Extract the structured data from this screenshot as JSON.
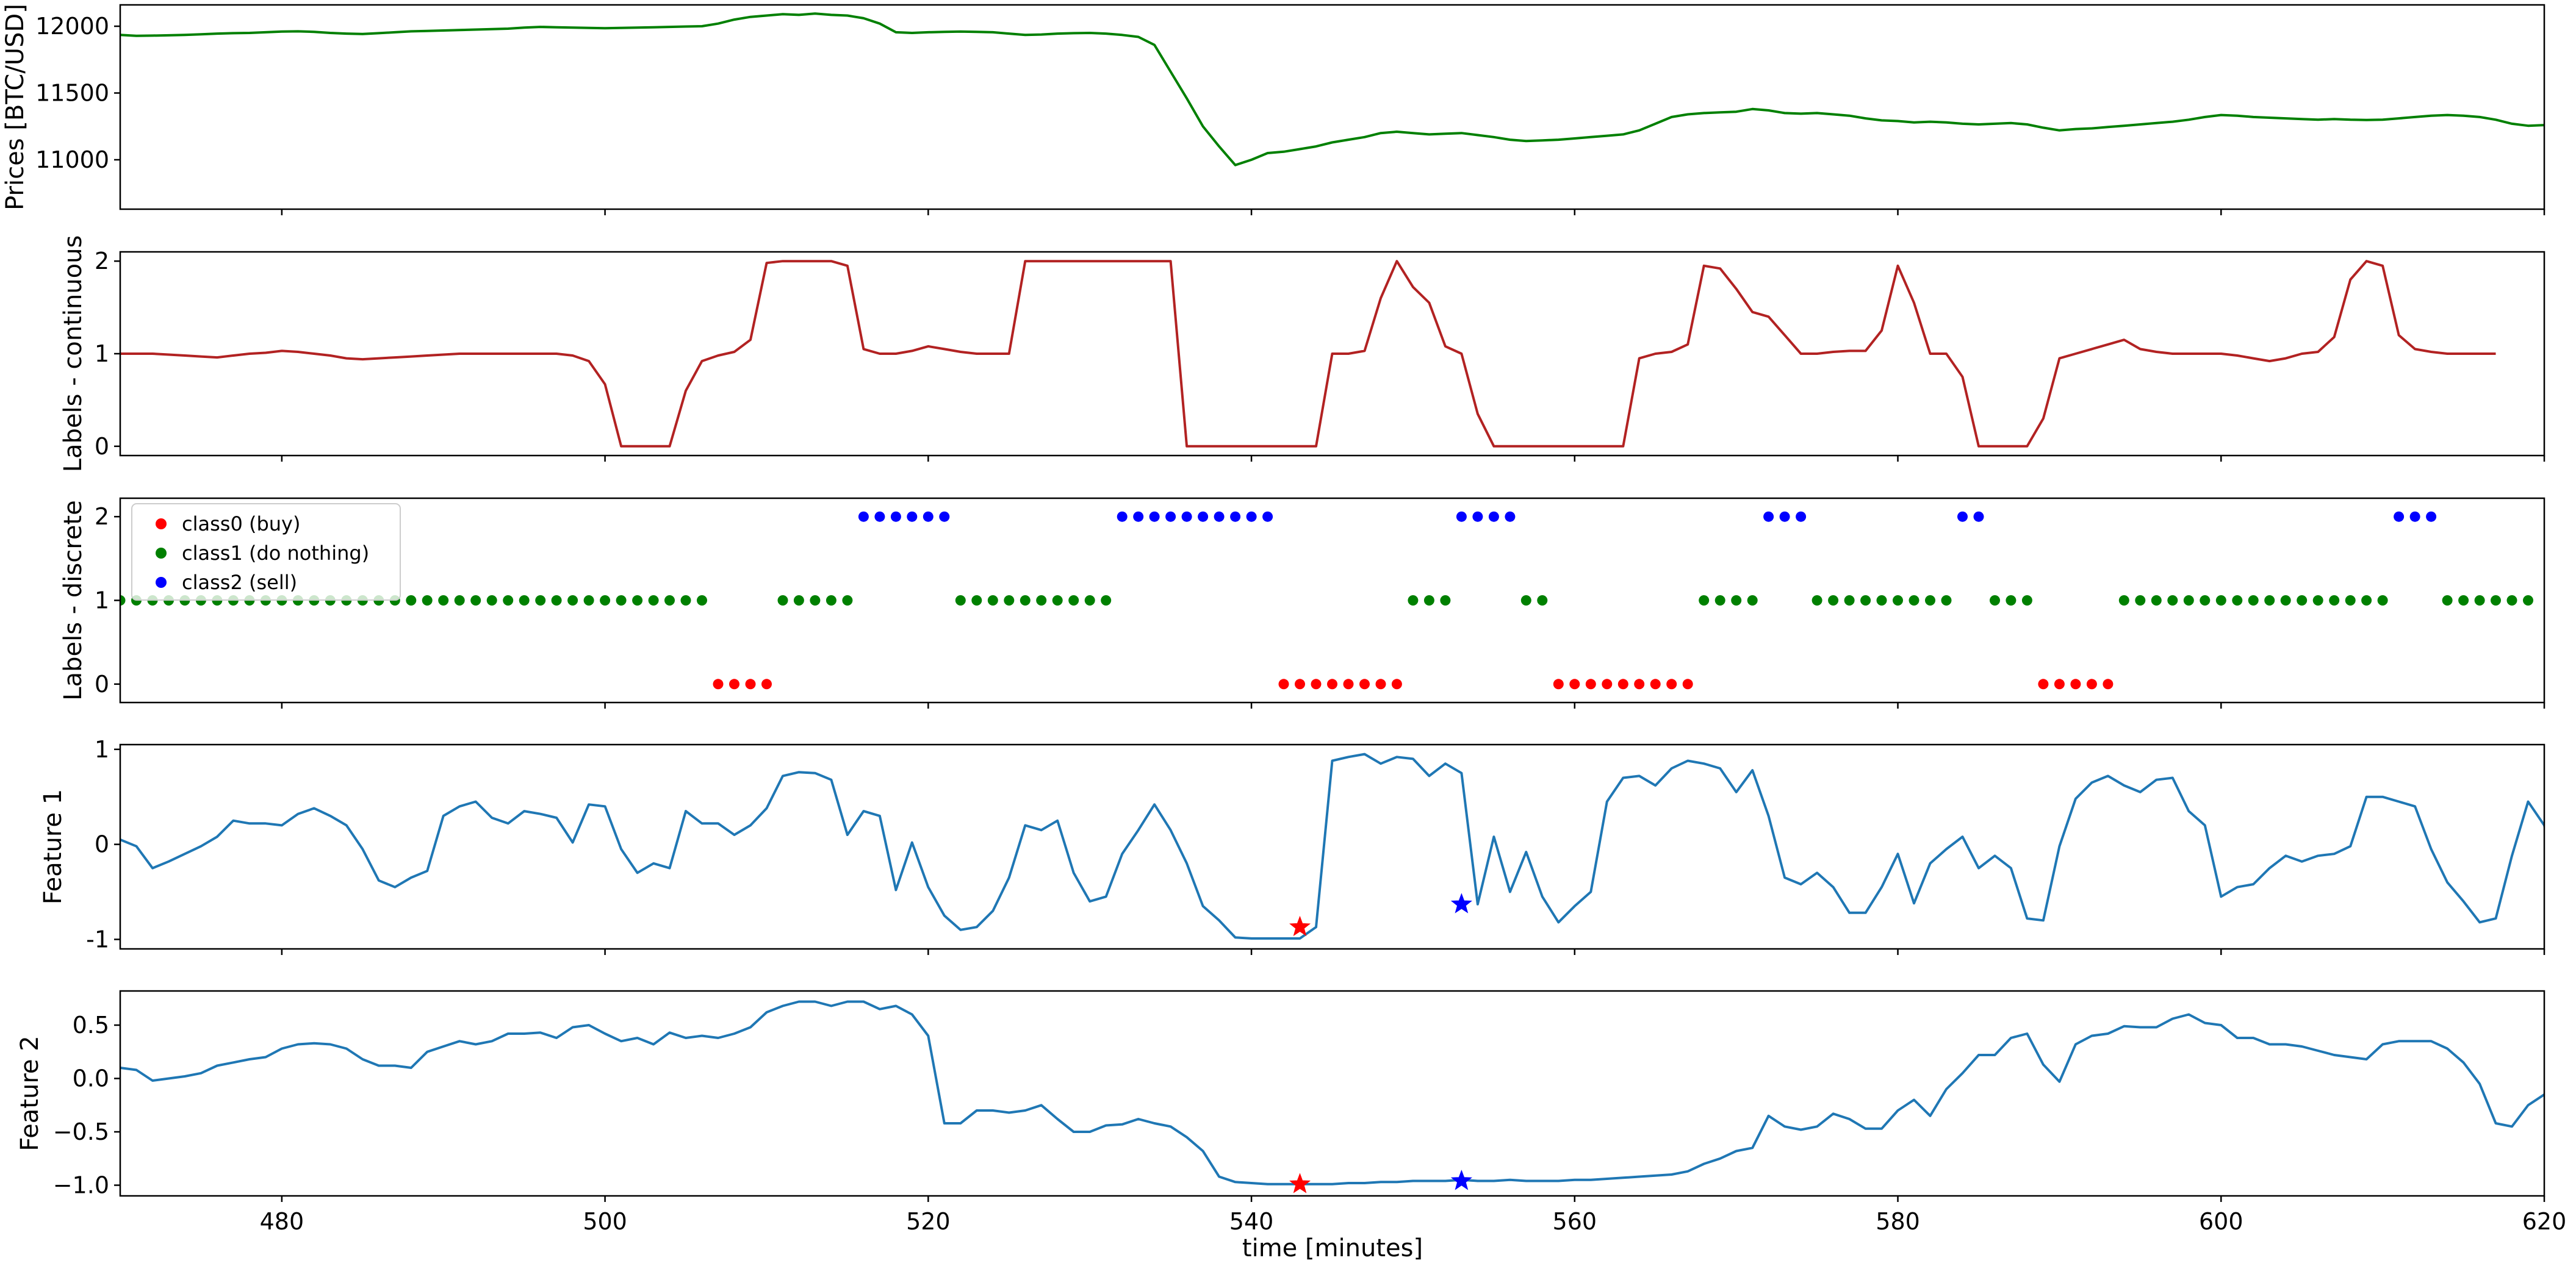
{
  "chart_data": {
    "type": "line",
    "x_label": "time [minutes]",
    "x_range": [
      470,
      620
    ],
    "x_ticks": [
      480,
      500,
      520,
      540,
      560,
      580,
      600,
      620
    ],
    "x_start": 470,
    "panels": [
      {
        "id": "prices",
        "ylabel": "Prices [BTC/USD]",
        "ylim": [
          10630,
          12160
        ],
        "yticks": [
          11000,
          11500,
          12000
        ],
        "color": "#008000",
        "kind": "line",
        "values": [
          11935,
          11928,
          11930,
          11932,
          11935,
          11940,
          11945,
          11948,
          11950,
          11955,
          11960,
          11962,
          11958,
          11950,
          11945,
          11942,
          11948,
          11955,
          11962,
          11965,
          11968,
          11972,
          11975,
          11978,
          11982,
          11990,
          11995,
          11992,
          11990,
          11988,
          11985,
          11988,
          11990,
          11992,
          11995,
          11998,
          12000,
          12020,
          12050,
          12070,
          12080,
          12090,
          12085,
          12095,
          12085,
          12080,
          12060,
          12020,
          11955,
          11950,
          11955,
          11958,
          11960,
          11958,
          11955,
          11945,
          11935,
          11938,
          11945,
          11948,
          11950,
          11945,
          11935,
          11920,
          11860,
          11660,
          11460,
          11250,
          11100,
          10960,
          11000,
          11050,
          11060,
          11080,
          11100,
          11130,
          11150,
          11170,
          11200,
          11210,
          11200,
          11190,
          11195,
          11200,
          11185,
          11170,
          11150,
          11140,
          11145,
          11150,
          11160,
          11170,
          11180,
          11190,
          11220,
          11270,
          11320,
          11340,
          11350,
          11355,
          11360,
          11380,
          11370,
          11350,
          11345,
          11350,
          11340,
          11330,
          11310,
          11295,
          11290,
          11280,
          11285,
          11280,
          11270,
          11265,
          11270,
          11275,
          11265,
          11240,
          11220,
          11230,
          11235,
          11245,
          11255,
          11265,
          11275,
          11285,
          11300,
          11320,
          11335,
          11330,
          11320,
          11315,
          11310,
          11305,
          11300,
          11305,
          11300,
          11298,
          11300,
          11310,
          11320,
          11330,
          11335,
          11330,
          11320,
          11300,
          11270,
          11255,
          11260,
          11270,
          11280,
          11270,
          11255
        ]
      },
      {
        "id": "labels_continuous",
        "ylabel": "Labels - continuous",
        "ylim": [
          -0.1,
          2.1
        ],
        "yticks": [
          0,
          1,
          2
        ],
        "color": "#b22222",
        "kind": "line",
        "values": [
          1.0,
          1.0,
          1.0,
          0.99,
          0.98,
          0.97,
          0.96,
          0.98,
          1.0,
          1.01,
          1.03,
          1.02,
          1.0,
          0.98,
          0.95,
          0.94,
          0.95,
          0.96,
          0.97,
          0.98,
          0.99,
          1.0,
          1.0,
          1.0,
          1.0,
          1.0,
          1.0,
          1.0,
          0.98,
          0.92,
          0.67,
          0.0,
          0.0,
          0.0,
          0.0,
          0.6,
          0.92,
          0.98,
          1.02,
          1.15,
          1.98,
          2.0,
          2.0,
          2.0,
          2.0,
          1.95,
          1.05,
          1.0,
          1.0,
          1.03,
          1.08,
          1.05,
          1.02,
          1.0,
          1.0,
          1.0,
          2.0,
          2.0,
          2.0,
          2.0,
          2.0,
          2.0,
          2.0,
          2.0,
          2.0,
          2.0,
          0.0,
          0.0,
          0.0,
          0.0,
          0.0,
          0.0,
          0.0,
          0.0,
          0.0,
          1.0,
          1.0,
          1.03,
          1.6,
          2.0,
          1.72,
          1.55,
          1.08,
          1.0,
          0.35,
          0.0,
          0.0,
          0.0,
          0.0,
          0.0,
          0.0,
          0.0,
          0.0,
          0.0,
          0.95,
          1.0,
          1.02,
          1.1,
          1.95,
          1.92,
          1.7,
          1.45,
          1.4,
          1.2,
          1.0,
          1.0,
          1.02,
          1.03,
          1.03,
          1.25,
          1.95,
          1.55,
          1.0,
          1.0,
          0.75,
          0.0,
          0.0,
          0.0,
          0.0,
          0.3,
          0.95,
          1.0,
          1.05,
          1.1,
          1.15,
          1.05,
          1.02,
          1.0,
          1.0,
          1.0,
          1.0,
          0.98,
          0.95,
          0.92,
          0.95,
          1.0,
          1.02,
          1.18,
          1.8,
          2.0,
          1.95,
          1.2,
          1.05,
          1.02,
          1.0,
          1.0,
          1.0,
          1.0
        ]
      },
      {
        "id": "labels_discrete",
        "ylabel": "Labels - discrete",
        "ylim": [
          -0.22,
          2.22
        ],
        "yticks": [
          0,
          1,
          2
        ],
        "kind": "scatter",
        "legend": [
          {
            "label": "class0 (buy)",
            "color": "#ff0000"
          },
          {
            "label": "class1 (do nothing)",
            "color": "#008000"
          },
          {
            "label": "class2 (sell)",
            "color": "#0000ff"
          }
        ],
        "values": [
          1,
          1,
          1,
          1,
          1,
          1,
          1,
          1,
          1,
          1,
          1,
          1,
          1,
          1,
          1,
          1,
          1,
          1,
          1,
          1,
          1,
          1,
          1,
          1,
          1,
          1,
          1,
          1,
          1,
          1,
          1,
          1,
          1,
          1,
          1,
          1,
          1,
          0,
          0,
          0,
          0,
          1,
          1,
          1,
          1,
          1,
          2,
          2,
          2,
          2,
          2,
          2,
          1,
          1,
          1,
          1,
          1,
          1,
          1,
          1,
          1,
          1,
          2,
          2,
          2,
          2,
          2,
          2,
          2,
          2,
          2,
          2,
          0,
          0,
          0,
          0,
          0,
          0,
          0,
          0,
          1,
          1,
          1,
          2,
          2,
          2,
          2,
          1,
          1,
          0,
          0,
          0,
          0,
          0,
          0,
          0,
          0,
          0,
          1,
          1,
          1,
          1,
          2,
          2,
          2,
          1,
          1,
          1,
          1,
          1,
          1,
          1,
          1,
          1,
          2,
          2,
          1,
          1,
          1,
          0,
          0,
          0,
          0,
          0,
          1,
          1,
          1,
          1,
          1,
          1,
          1,
          1,
          1,
          1,
          1,
          1,
          1,
          1,
          1,
          1,
          1,
          2,
          2,
          2,
          1,
          1,
          1,
          1,
          1,
          1
        ]
      },
      {
        "id": "feature1",
        "ylabel": "Feature 1",
        "ylim": [
          -1.1,
          1.05
        ],
        "yticks": [
          -1,
          0,
          1
        ],
        "color": "#1f77b4",
        "kind": "line",
        "markers": [
          {
            "x": 543,
            "y": -0.87,
            "color": "#ff0000"
          },
          {
            "x": 553,
            "y": -0.63,
            "color": "#0000ff"
          }
        ],
        "values": [
          0.05,
          -0.02,
          -0.25,
          -0.18,
          -0.1,
          -0.02,
          0.08,
          0.25,
          0.22,
          0.22,
          0.2,
          0.32,
          0.38,
          0.3,
          0.2,
          -0.05,
          -0.38,
          -0.45,
          -0.35,
          -0.28,
          0.3,
          0.4,
          0.45,
          0.28,
          0.22,
          0.35,
          0.32,
          0.28,
          0.02,
          0.42,
          0.4,
          -0.05,
          -0.3,
          -0.2,
          -0.25,
          0.35,
          0.22,
          0.22,
          0.1,
          0.2,
          0.38,
          0.72,
          0.76,
          0.75,
          0.68,
          0.1,
          0.35,
          0.3,
          -0.48,
          0.02,
          -0.45,
          -0.75,
          -0.9,
          -0.87,
          -0.7,
          -0.35,
          0.2,
          0.15,
          0.25,
          -0.3,
          -0.6,
          -0.55,
          -0.1,
          0.15,
          0.42,
          0.15,
          -0.2,
          -0.65,
          -0.8,
          -0.98,
          -0.99,
          -0.99,
          -0.99,
          -0.99,
          -0.87,
          0.88,
          0.92,
          0.95,
          0.85,
          0.92,
          0.9,
          0.72,
          0.85,
          0.75,
          -0.63,
          0.08,
          -0.5,
          -0.08,
          -0.55,
          -0.82,
          -0.65,
          -0.5,
          0.45,
          0.7,
          0.72,
          0.62,
          0.8,
          0.88,
          0.85,
          0.8,
          0.55,
          0.78,
          0.3,
          -0.35,
          -0.42,
          -0.3,
          -0.45,
          -0.72,
          -0.72,
          -0.45,
          -0.1,
          -0.62,
          -0.2,
          -0.05,
          0.08,
          -0.25,
          -0.12,
          -0.25,
          -0.78,
          -0.8,
          -0.02,
          0.48,
          0.65,
          0.72,
          0.62,
          0.55,
          0.68,
          0.7,
          0.35,
          0.2,
          -0.55,
          -0.45,
          -0.42,
          -0.25,
          -0.12,
          -0.18,
          -0.12,
          -0.1,
          -0.02,
          0.5,
          0.5,
          0.45,
          0.4,
          -0.05,
          -0.4,
          -0.6,
          -0.82,
          -0.78,
          -0.12,
          0.45,
          0.2,
          -0.45
        ]
      },
      {
        "id": "feature2",
        "ylabel": "Feature 2",
        "ylim": [
          -1.1,
          0.82
        ],
        "yticks": [
          -1.0,
          -0.5,
          0.0,
          0.5
        ],
        "tick_labels": [
          "−1.0",
          "−0.5",
          "0.0",
          "0.5"
        ],
        "color": "#1f77b4",
        "kind": "line",
        "markers": [
          {
            "x": 543,
            "y": -0.99,
            "color": "#ff0000"
          },
          {
            "x": 553,
            "y": -0.96,
            "color": "#0000ff"
          }
        ],
        "values": [
          0.1,
          0.08,
          -0.02,
          0.0,
          0.02,
          0.05,
          0.12,
          0.15,
          0.18,
          0.2,
          0.28,
          0.32,
          0.33,
          0.32,
          0.28,
          0.18,
          0.12,
          0.12,
          0.1,
          0.25,
          0.3,
          0.35,
          0.32,
          0.35,
          0.42,
          0.42,
          0.43,
          0.38,
          0.48,
          0.5,
          0.42,
          0.35,
          0.38,
          0.32,
          0.43,
          0.38,
          0.4,
          0.38,
          0.42,
          0.48,
          0.62,
          0.68,
          0.72,
          0.72,
          0.68,
          0.72,
          0.72,
          0.65,
          0.68,
          0.6,
          0.4,
          -0.42,
          -0.42,
          -0.3,
          -0.3,
          -0.32,
          -0.3,
          -0.25,
          -0.38,
          -0.5,
          -0.5,
          -0.44,
          -0.43,
          -0.38,
          -0.42,
          -0.45,
          -0.55,
          -0.68,
          -0.92,
          -0.97,
          -0.98,
          -0.99,
          -0.99,
          -0.99,
          -0.99,
          -0.99,
          -0.98,
          -0.98,
          -0.97,
          -0.97,
          -0.96,
          -0.96,
          -0.96,
          -0.95,
          -0.96,
          -0.96,
          -0.95,
          -0.96,
          -0.96,
          -0.96,
          -0.95,
          -0.95,
          -0.94,
          -0.93,
          -0.92,
          -0.91,
          -0.9,
          -0.87,
          -0.8,
          -0.75,
          -0.68,
          -0.65,
          -0.35,
          -0.45,
          -0.48,
          -0.45,
          -0.33,
          -0.38,
          -0.47,
          -0.47,
          -0.3,
          -0.2,
          -0.35,
          -0.1,
          0.05,
          0.22,
          0.22,
          0.38,
          0.42,
          0.13,
          -0.03,
          0.32,
          0.4,
          0.42,
          0.49,
          0.48,
          0.48,
          0.56,
          0.6,
          0.52,
          0.5,
          0.38,
          0.38,
          0.32,
          0.32,
          0.3,
          0.26,
          0.22,
          0.2,
          0.18,
          0.32,
          0.35,
          0.35,
          0.35,
          0.28,
          0.15,
          -0.05,
          -0.42,
          -0.45,
          -0.25,
          -0.15,
          -0.28,
          -0.38
        ]
      }
    ]
  }
}
